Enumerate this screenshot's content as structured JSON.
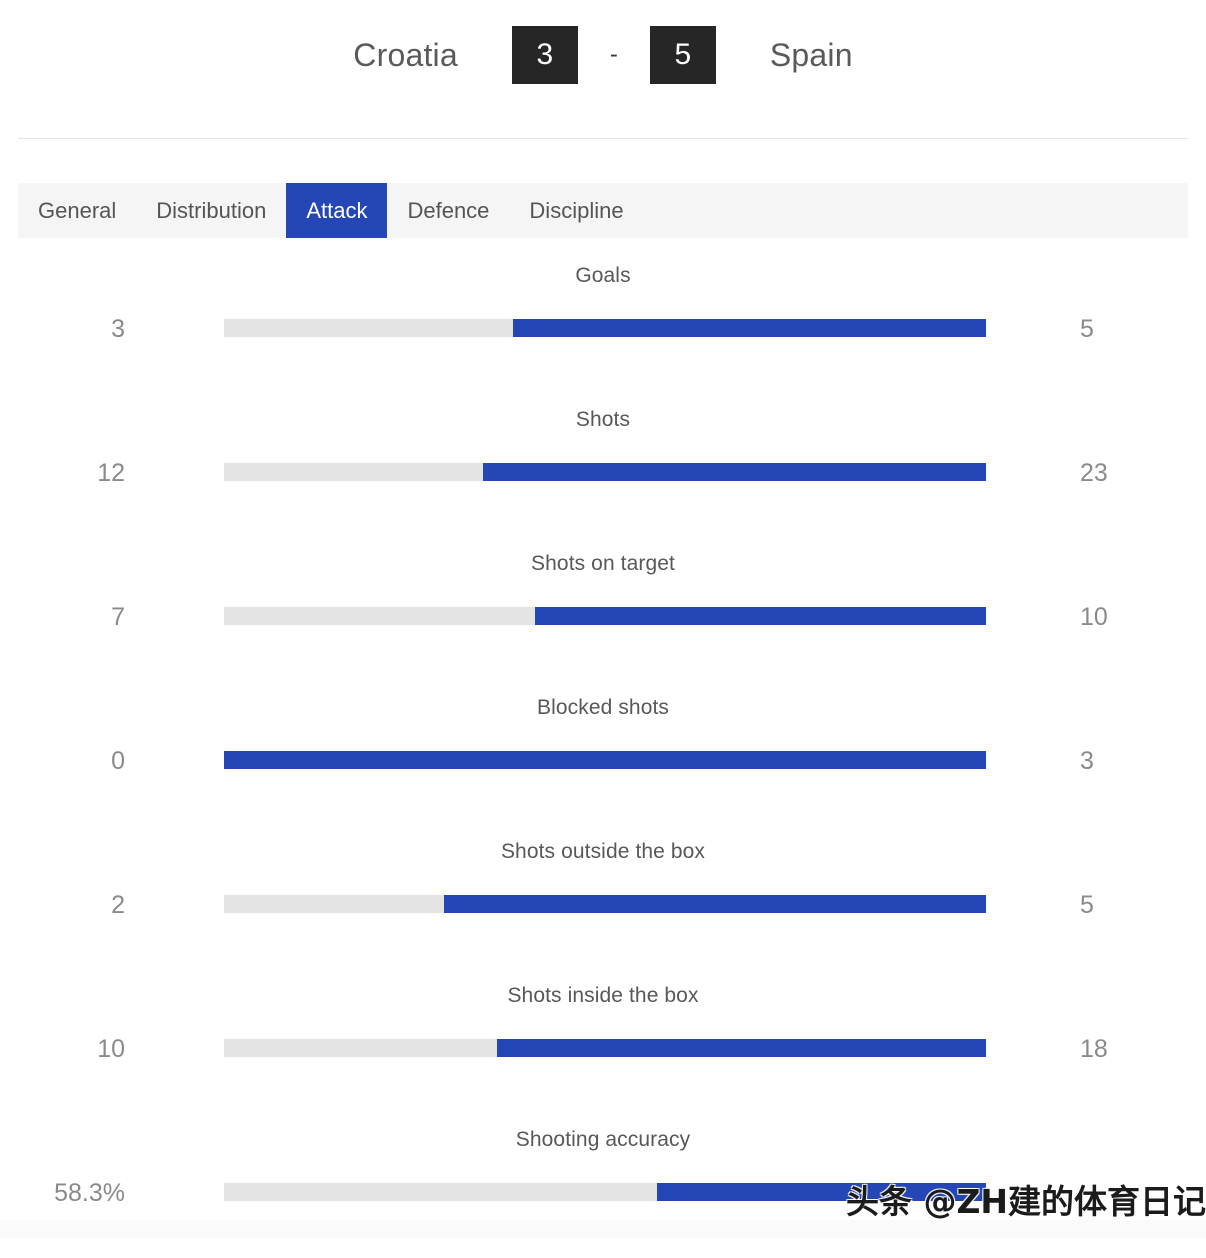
{
  "scoreboard": {
    "home_team": "Croatia",
    "home_score": "3",
    "separator": "-",
    "away_score": "5",
    "away_team": "Spain"
  },
  "tabs": [
    {
      "label": "General",
      "active": false
    },
    {
      "label": "Distribution",
      "active": false
    },
    {
      "label": "Attack",
      "active": true
    },
    {
      "label": "Defence",
      "active": false
    },
    {
      "label": "Discipline",
      "active": false
    }
  ],
  "colors": {
    "accent_blue": "#2447b5",
    "track_gray": "#e4e4e4",
    "score_box": "#262626",
    "tab_strip": "#f5f5f5"
  },
  "watermark": {
    "text": "头条 @ZH建的体育日记"
  },
  "chart_data": {
    "type": "bar",
    "title": "Croatia 3 - 5 Spain — Attack",
    "orientation": "horizontal-diverging",
    "series": [
      {
        "name": "Croatia",
        "color": "#e4e4e4"
      },
      {
        "name": "Spain",
        "color": "#2447b5"
      }
    ],
    "categories": [
      "Goals",
      "Shots",
      "Shots on target",
      "Blocked shots",
      "Shots outside the box",
      "Shots inside the box",
      "Shooting accuracy"
    ],
    "rows": [
      {
        "label": "Goals",
        "home": "3",
        "away": "5",
        "home_pct": 37.9
      },
      {
        "label": "Shots",
        "home": "12",
        "away": "23",
        "home_pct": 34.0
      },
      {
        "label": "Shots on target",
        "home": "7",
        "away": "10",
        "home_pct": 40.8
      },
      {
        "label": "Blocked shots",
        "home": "0",
        "away": "3",
        "home_pct": 0.0
      },
      {
        "label": "Shots outside the box",
        "home": "2",
        "away": "5",
        "home_pct": 28.9
      },
      {
        "label": "Shots inside the box",
        "home": "10",
        "away": "18",
        "home_pct": 35.8
      },
      {
        "label": "Shooting accuracy",
        "home": "58.3%",
        "away": "",
        "home_pct": 56.8
      }
    ]
  }
}
